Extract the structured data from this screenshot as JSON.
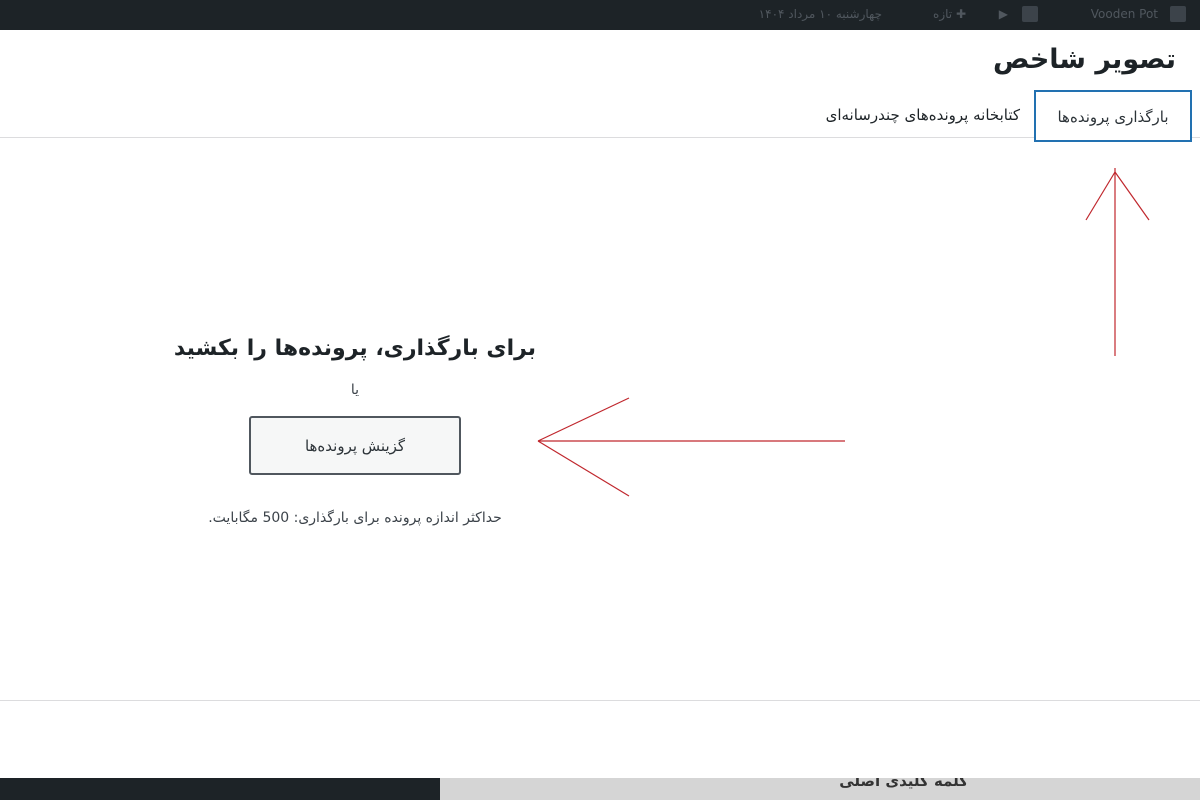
{
  "admin_bar": {
    "site_name": "Vooden Pot",
    "new_label": "تازه",
    "date_text": "چهارشنبه ۱۰ مرداد ۱۴۰۴"
  },
  "modal": {
    "title": "تصویر شاخص",
    "tabs": [
      {
        "label": "بارگذاری پرونده‌ها",
        "active": true
      },
      {
        "label": "کتابخانه پرونده‌های چندرسانه‌ای",
        "active": false
      }
    ],
    "upload": {
      "drop_title": "برای بارگذاری، پرونده‌ها را بکشید",
      "or_text": "یا",
      "select_button": "گزینش پرونده‌ها",
      "max_size_text": "حداکثر اندازه پرونده برای بارگذاری: 500 مگابایت."
    }
  },
  "background": {
    "bottom_text": "کلمه کلیدی اصلی"
  },
  "colors": {
    "accent": "#2271b1",
    "annotation": "#c0272d",
    "admin_bar": "#1d2327"
  }
}
